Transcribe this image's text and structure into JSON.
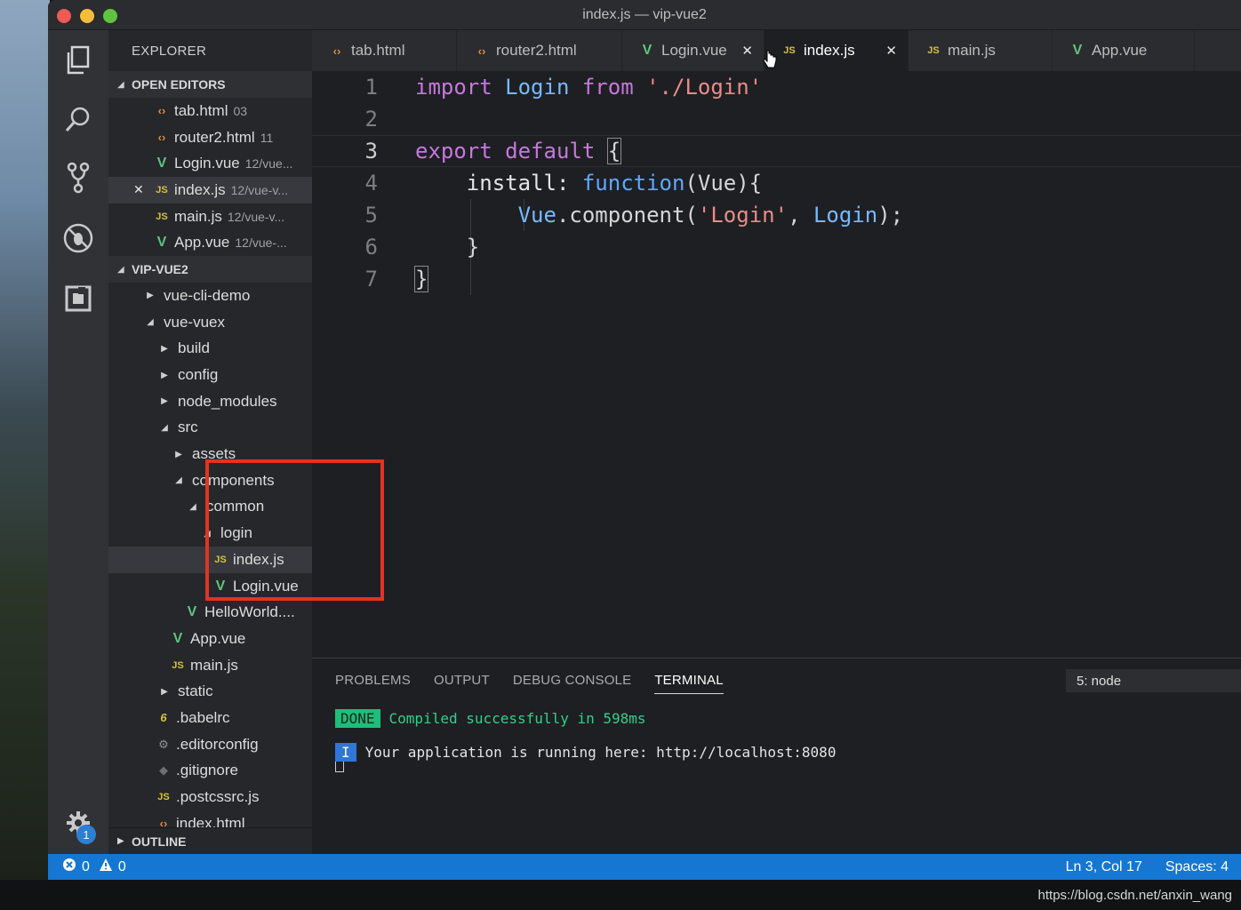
{
  "window": {
    "title": "index.js — vip-vue2"
  },
  "sidebar": {
    "header": "EXPLORER",
    "open_editors_header": "OPEN EDITORS",
    "open_editors": [
      {
        "icon": "html-file-icon",
        "name": "tab.html",
        "desc": "03"
      },
      {
        "icon": "html-file-icon",
        "name": "router2.html",
        "desc": "11"
      },
      {
        "icon": "vue-file-icon",
        "name": "Login.vue",
        "desc": "12/vue..."
      },
      {
        "icon": "js-file-icon",
        "name": "index.js",
        "desc": "12/vue-v..."
      },
      {
        "icon": "js-file-icon",
        "name": "main.js",
        "desc": "12/vue-v..."
      },
      {
        "icon": "vue-file-icon",
        "name": "App.vue",
        "desc": "12/vue-..."
      }
    ],
    "project_header": "VIP-VUE2",
    "tree": [
      {
        "name": "vue-cli-demo",
        "type": "folder-closed"
      },
      {
        "name": "vue-vuex",
        "type": "folder-open"
      },
      {
        "name": "build",
        "type": "folder-closed"
      },
      {
        "name": "config",
        "type": "folder-closed"
      },
      {
        "name": "node_modules",
        "type": "folder-closed"
      },
      {
        "name": "src",
        "type": "folder-open"
      },
      {
        "name": "assets",
        "type": "folder-closed"
      },
      {
        "name": "components",
        "type": "folder-open"
      },
      {
        "name": "common",
        "type": "folder-open"
      },
      {
        "name": "login",
        "type": "folder-open"
      },
      {
        "name": "index.js",
        "type": "js-file"
      },
      {
        "name": "Login.vue",
        "type": "vue-file"
      },
      {
        "name": "HelloWorld....",
        "type": "vue-file"
      },
      {
        "name": "App.vue",
        "type": "vue-file"
      },
      {
        "name": "main.js",
        "type": "js-file"
      },
      {
        "name": "static",
        "type": "folder-closed"
      },
      {
        "name": ".babelrc",
        "type": "babel-file"
      },
      {
        "name": ".editorconfig",
        "type": "config-file"
      },
      {
        "name": ".gitignore",
        "type": "git-file"
      },
      {
        "name": ".postcssrc.js",
        "type": "js-file"
      },
      {
        "name": "index.html",
        "type": "html-file"
      }
    ],
    "outline_header": "OUTLINE",
    "settings_badge": "1"
  },
  "tabs": [
    {
      "icon": "html-file-icon",
      "label": "tab.html"
    },
    {
      "icon": "html-file-icon",
      "label": "router2.html"
    },
    {
      "icon": "vue-file-icon",
      "label": "Login.vue"
    },
    {
      "icon": "js-file-icon",
      "label": "index.js",
      "active": true
    },
    {
      "icon": "js-file-icon",
      "label": "main.js"
    },
    {
      "icon": "vue-file-icon",
      "label": "App.vue"
    }
  ],
  "editor": {
    "line_numbers": [
      "1",
      "2",
      "3",
      "4",
      "5",
      "6",
      "7"
    ],
    "code": {
      "l1_import": "import",
      "l1_login": "Login",
      "l1_from": "from",
      "l1_path": "'./Login'",
      "l3_export": "export",
      "l3_default": "default",
      "l3_brace": "{",
      "l4_install": "install:",
      "l4_function": "function",
      "l4_params": "(Vue){",
      "l5_vue": "Vue",
      "l5_component": ".component(",
      "l5_name": "'Login'",
      "l5_comma": ",",
      "l5_login": "Login",
      "l5_end": ");",
      "l6_close": "}",
      "l7_close": "}"
    }
  },
  "panel": {
    "tabs": [
      "PROBLEMS",
      "OUTPUT",
      "DEBUG CONSOLE",
      "TERMINAL"
    ],
    "active_tab": "TERMINAL",
    "terminal_select": "5: node",
    "done_badge": "DONE",
    "done_text": "Compiled successfully in 598ms",
    "info_badge": "I",
    "info_text": "Your application is running here: http://localhost:8080"
  },
  "statusbar": {
    "errors": "0",
    "warnings": "0",
    "cursor_pos": "Ln 3, Col 17",
    "spaces": "Spaces: 4"
  },
  "watermark": "https://blog.csdn.net/anxin_wang",
  "colors": {
    "accent": "#1577d1",
    "highlight_box": "#e6321f",
    "keyword": "#c678dd",
    "string": "#e98b8b"
  }
}
